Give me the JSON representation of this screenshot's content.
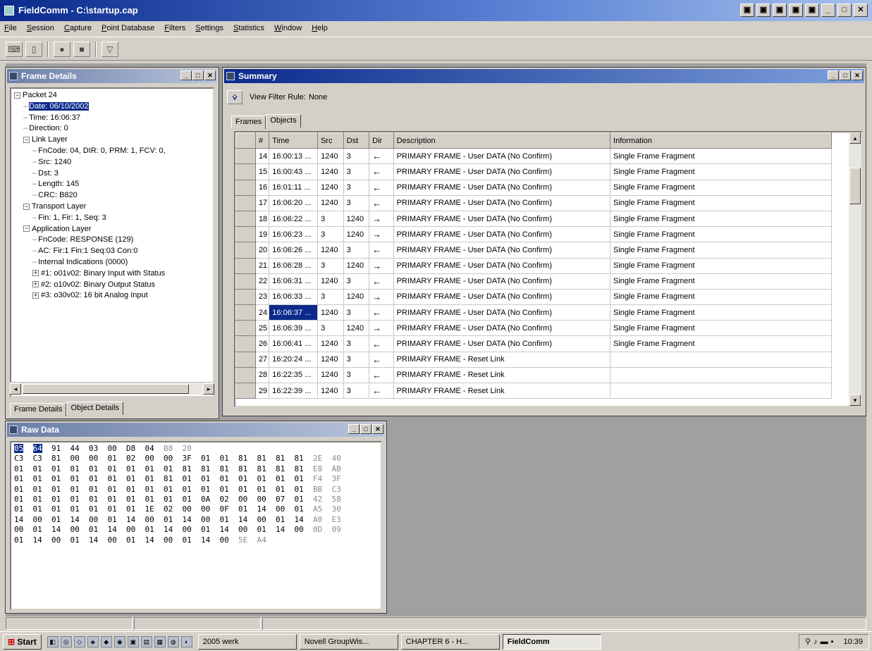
{
  "app": {
    "title": "FieldComm - C:\\startup.cap"
  },
  "title_buttons": [
    "▣",
    "▣",
    "▣",
    "▣",
    "▣",
    "_",
    "□",
    "✕"
  ],
  "menu": [
    "File",
    "Session",
    "Capture",
    "Point Database",
    "Filters",
    "Settings",
    "Statistics",
    "Window",
    "Help"
  ],
  "toolbar": {
    "icons": [
      "open-icon",
      "new-icon",
      "record-icon",
      "stop-icon",
      "filter-icon"
    ]
  },
  "frame_details": {
    "title": "Frame Details",
    "tree": [
      {
        "indent": 0,
        "expander": "⊟",
        "text": "Packet 24"
      },
      {
        "indent": 1,
        "expander": "",
        "text": "Date: 06/10/2002",
        "selected": true
      },
      {
        "indent": 1,
        "expander": "",
        "text": "Time: 16:06:37"
      },
      {
        "indent": 1,
        "expander": "",
        "text": "Direction: 0"
      },
      {
        "indent": 1,
        "expander": "⊟",
        "text": "Link Layer"
      },
      {
        "indent": 2,
        "expander": "",
        "text": "FnCode: 04, DIR: 0, PRM: 1, FCV: 0,"
      },
      {
        "indent": 2,
        "expander": "",
        "text": "Src: 1240"
      },
      {
        "indent": 2,
        "expander": "",
        "text": "Dst: 3"
      },
      {
        "indent": 2,
        "expander": "",
        "text": "Length: 145"
      },
      {
        "indent": 2,
        "expander": "",
        "text": "CRC: B820"
      },
      {
        "indent": 1,
        "expander": "⊟",
        "text": "Transport Layer"
      },
      {
        "indent": 2,
        "expander": "",
        "text": "Fin: 1, Fir: 1, Seq: 3"
      },
      {
        "indent": 1,
        "expander": "⊟",
        "text": "Application Layer"
      },
      {
        "indent": 2,
        "expander": "",
        "text": "FnCode: RESPONSE (129)"
      },
      {
        "indent": 2,
        "expander": "",
        "text": "AC: Fir:1 Fin:1 Seq:03 Con:0"
      },
      {
        "indent": 2,
        "expander": "",
        "text": "Internal Indications (0000)"
      },
      {
        "indent": 2,
        "expander": "⊞",
        "text": "#1: o01v02: Binary Input with Status"
      },
      {
        "indent": 2,
        "expander": "⊞",
        "text": "#2: o10v02: Binary Output Status"
      },
      {
        "indent": 2,
        "expander": "⊞",
        "text": "#3: o30v02: 16 bit Analog Input"
      }
    ],
    "tabs": [
      "Frame Details",
      "Object Details"
    ]
  },
  "summary": {
    "title": "Summary",
    "filter_label": "View Filter Rule:",
    "filter_value": "None",
    "tabs": [
      "Frames",
      "Objects"
    ],
    "columns": [
      "#",
      "Time",
      "Src",
      "Dst",
      "Dir",
      "Description",
      "Information"
    ],
    "rows": [
      [
        "14",
        "16:00:13 ...",
        "1240",
        "3",
        "←",
        "PRIMARY FRAME - User DATA (No Confirm)",
        "Single Frame Fragment"
      ],
      [
        "15",
        "16:00:43 ...",
        "1240",
        "3",
        "←",
        "PRIMARY FRAME - User DATA (No Confirm)",
        "Single Frame Fragment"
      ],
      [
        "16",
        "16:01:11 ...",
        "1240",
        "3",
        "←",
        "PRIMARY FRAME - User DATA (No Confirm)",
        "Single Frame Fragment"
      ],
      [
        "17",
        "16:06:20 ...",
        "1240",
        "3",
        "←",
        "PRIMARY FRAME - User DATA (No Confirm)",
        "Single Frame Fragment"
      ],
      [
        "18",
        "16:06:22 ...",
        "3",
        "1240",
        "→",
        "PRIMARY FRAME - User DATA (No Confirm)",
        "Single Frame Fragment"
      ],
      [
        "19",
        "16:06:23 ...",
        "3",
        "1240",
        "→",
        "PRIMARY FRAME - User DATA (No Confirm)",
        "Single Frame Fragment"
      ],
      [
        "20",
        "16:06:26 ...",
        "1240",
        "3",
        "←",
        "PRIMARY FRAME - User DATA (No Confirm)",
        "Single Frame Fragment"
      ],
      [
        "21",
        "16:06:28 ...",
        "3",
        "1240",
        "→",
        "PRIMARY FRAME - User DATA (No Confirm)",
        "Single Frame Fragment"
      ],
      [
        "22",
        "16:06:31 ...",
        "1240",
        "3",
        "←",
        "PRIMARY FRAME - User DATA (No Confirm)",
        "Single Frame Fragment"
      ],
      [
        "23",
        "16:06:33 ...",
        "3",
        "1240",
        "→",
        "PRIMARY FRAME - User DATA (No Confirm)",
        "Single Frame Fragment"
      ],
      [
        "24",
        "16:06:37 ...",
        "1240",
        "3",
        "←",
        "PRIMARY FRAME - User DATA (No Confirm)",
        "Single Frame Fragment"
      ],
      [
        "25",
        "16:06:39 ...",
        "3",
        "1240",
        "→",
        "PRIMARY FRAME - User DATA (No Confirm)",
        "Single Frame Fragment"
      ],
      [
        "26",
        "16:06:41 ...",
        "1240",
        "3",
        "←",
        "PRIMARY FRAME - User DATA (No Confirm)",
        "Single Frame Fragment"
      ],
      [
        "27",
        "16:20:24 ...",
        "1240",
        "3",
        "←",
        "PRIMARY FRAME - Reset Link",
        ""
      ],
      [
        "28",
        "16:22:35 ...",
        "1240",
        "3",
        "←",
        "PRIMARY FRAME - Reset Link",
        ""
      ],
      [
        "29",
        "16:22:39 ...",
        "1240",
        "3",
        "←",
        "PRIMARY FRAME - Reset Link",
        ""
      ]
    ],
    "selected_row": "24"
  },
  "raw_data": {
    "title": "Raw Data",
    "lines": [
      "05 64 91 44 03 00 D8 04 B8 20",
      "C3 C3 81 00 00 01 02 00 00 3F 01 01 81 81 81 81 2E 40",
      "01 01 01 01 01 01 01 01 01 81 81 81 81 81 81 81 E8 AB",
      "01 01 01 01 01 01 01 01 81 01 01 01 01 01 01 01 F4 3F",
      "01 01 01 01 01 01 01 01 01 01 01 01 01 01 01 01 BB C3",
      "01 01 01 01 01 01 01 01 01 01 0A 02 00 00 07 01 42 58",
      "01 01 01 01 01 01 01 1E 02 00 00 0F 01 14 00 01 A5 30",
      "14 00 01 14 00 01 14 00 01 14 00 01 14 00 01 14 A0 E3",
      "00 01 14 00 01 14 00 01 14 00 01 14 00 01 14 00 0D 09",
      "01 14 00 01 14 00 01 14 00 01 14 00 5E A4"
    ]
  },
  "taskbar": {
    "start": "Start",
    "tasks": [
      "2005 werk",
      "Novell GroupWis...",
      "CHAPTER 6 - H...",
      "FieldComm"
    ],
    "active_task": "FieldComm",
    "clock": "10:39"
  },
  "colors": {
    "title_active": "#0b2a8c",
    "desktop": "#a0a0a0",
    "face": "#d4d0c8"
  }
}
